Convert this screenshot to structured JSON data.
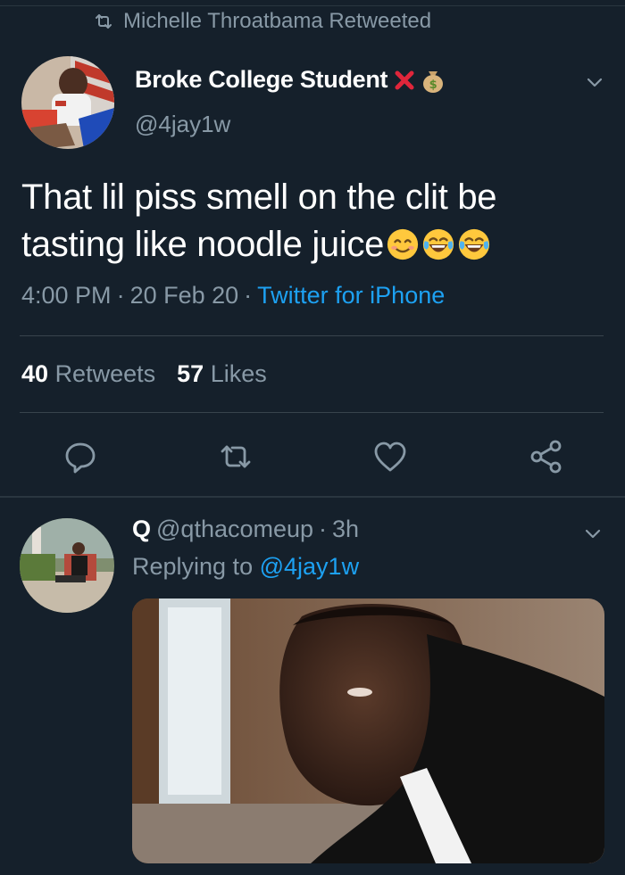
{
  "retweet_banner": {
    "text": "Michelle Throatbama Retweeted"
  },
  "tweet": {
    "name": "Broke College Student",
    "handle": "@4jay1w",
    "text_line1": "That lil piss smell on the clit be",
    "text_line2": "tasting like noodle juice",
    "time": "4:00 PM",
    "date": "20 Feb 20",
    "source": "Twitter for iPhone",
    "separator": "·",
    "retweets_count": "40",
    "retweets_label": "Retweets",
    "likes_count": "57",
    "likes_label": "Likes"
  },
  "reply": {
    "name": "Q",
    "handle": "@qthacomeup",
    "separator": "·",
    "age": "3h",
    "replying_prefix": "Replying to",
    "replying_to": "@4jay1w"
  },
  "colors": {
    "background": "#15202b",
    "muted": "#8899a6",
    "link": "#1da1f2",
    "divider": "#38444d"
  },
  "icons": {
    "name_badges": [
      "cross-mark-icon",
      "money-bag-icon"
    ],
    "tweet_emojis": [
      "smiling-face-icon",
      "tears-of-joy-icon",
      "tears-of-joy-icon"
    ],
    "actions": [
      "reply-icon",
      "retweet-icon",
      "like-icon",
      "share-icon"
    ]
  }
}
